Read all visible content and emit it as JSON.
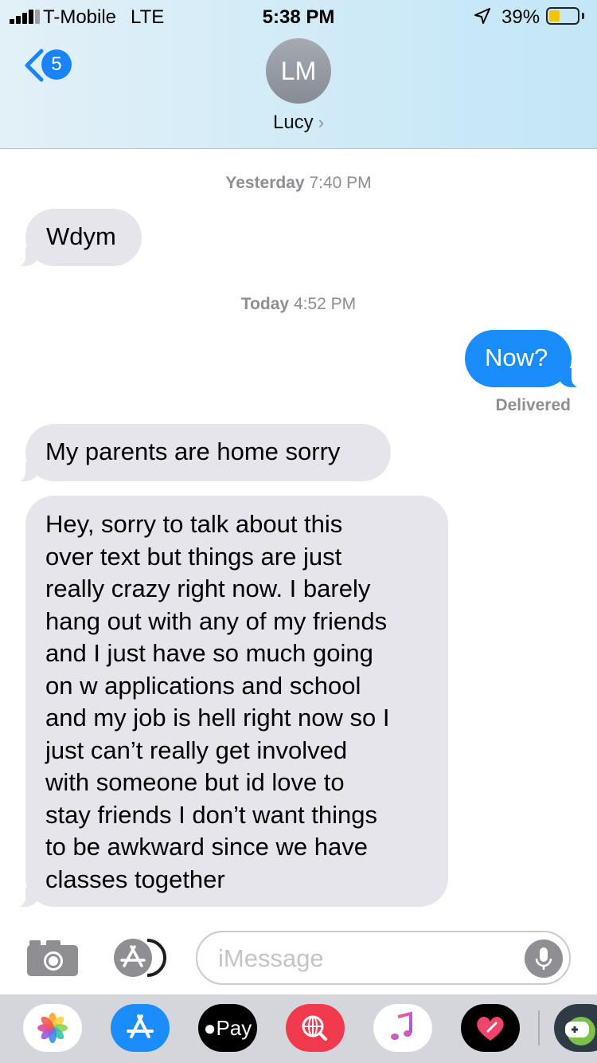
{
  "status_bar": {
    "carrier": "T-Mobile",
    "network": "LTE",
    "time": "5:38 PM",
    "battery": "39%",
    "battery_level": 0.39,
    "icons": [
      "signal-bars-icon",
      "location-arrow-icon",
      "battery-icon"
    ]
  },
  "nav": {
    "back_badge": "5",
    "avatar_initials": "LM",
    "contact_name": "Lucy",
    "contact_chevron": "›"
  },
  "thread": {
    "stamp1_day": "Yesterday",
    "stamp1_time": "7:40 PM",
    "msg1": "Wdym",
    "stamp2_day": "Today",
    "stamp2_time": "4:52 PM",
    "msg2": "Now?",
    "delivered": "Delivered",
    "msg3": "My parents are home sorry",
    "msg4_lines": [
      "Hey, sorry to talk about this",
      "over text but things are just",
      "really crazy right now. I barely",
      "hang out with any of my friends",
      "and I just have so much going",
      "on w applications and school",
      "and my job is hell right now so I",
      "just can’t really get involved",
      "with someone but id love to",
      "stay friends I don’t want things",
      "to be awkward since we have",
      "classes together"
    ]
  },
  "composer": {
    "placeholder": "iMessage",
    "icons": [
      "camera-icon",
      "app-store-icon",
      "microphone-icon"
    ]
  },
  "app_drawer": {
    "apple_pay_label": "Pay",
    "apps": [
      "photos-app-icon",
      "app-store-app-icon",
      "apple-pay-app-icon",
      "web-search-app-icon",
      "music-app-icon",
      "digital-touch-app-icon",
      "game-app-icon"
    ],
    "colors": {
      "app_store": "#1a8cfc",
      "search": "#f23a4e",
      "apple_pay": "#000000"
    }
  }
}
